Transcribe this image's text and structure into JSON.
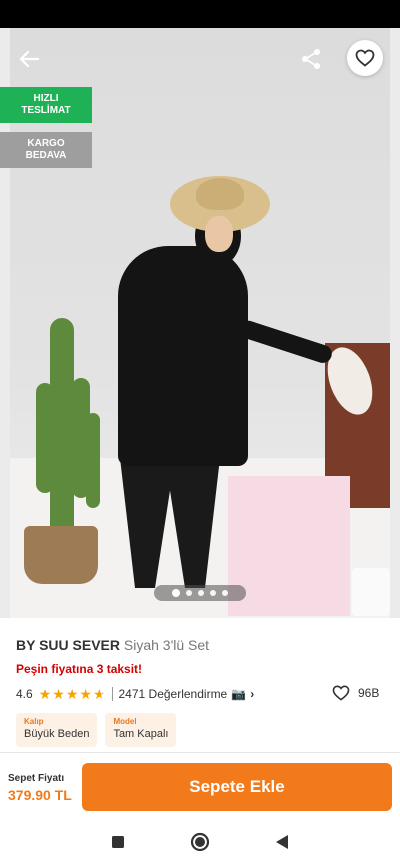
{
  "header": {
    "back_icon": "arrow-left-icon",
    "share_icon": "share-icon",
    "favorite_icon": "heart-outline-icon"
  },
  "badges": {
    "fast_delivery": "HIZLI TESLİMAT",
    "free_cargo": "KARGO BEDAVA"
  },
  "gallery": {
    "dot_count": 5,
    "active_index": 0
  },
  "product": {
    "brand": "BY SUU SEVER",
    "name": "Siyah 3'lü Set",
    "installment_text": "Peşin fiyatına 3 taksit!",
    "rating": "4.6",
    "stars_filled": 4.6,
    "review_count": "2471 Değerlendirme",
    "favorites": "96B",
    "attributes": [
      {
        "label": "Kalıp",
        "value": "Büyük Beden"
      },
      {
        "label": "Model",
        "value": "Tam Kapalı"
      }
    ]
  },
  "bottom_bar": {
    "price_label": "Sepet Fiyatı",
    "price": "379.90 TL",
    "add_to_cart": "Sepete Ekle"
  },
  "colors": {
    "accent": "#f27a1a",
    "fast_badge": "#1fb155",
    "cargo_badge": "#9e9e9e",
    "installment": "#d50000",
    "star": "#f6a500"
  }
}
